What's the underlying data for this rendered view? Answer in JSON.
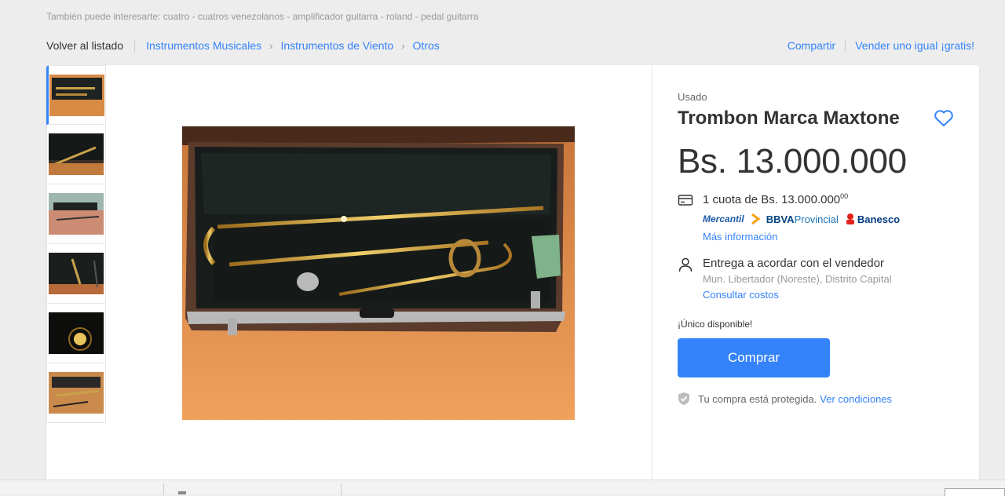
{
  "related": {
    "prefix": "También puede interesarte:",
    "items": [
      "cuatro",
      "cuatros venezolanos",
      "amplificador guitarra",
      "roland",
      "pedal guitarra"
    ],
    "sep": " - "
  },
  "breadcrumb": {
    "back_label": "Volver al listado",
    "items": [
      "Instrumentos Musicales",
      "Instrumentos de Viento",
      "Otros"
    ],
    "chevron": "›"
  },
  "actions": {
    "share_label": "Compartir",
    "sell_label": "Vender uno igual ¡gratis!"
  },
  "gallery": {
    "thumb_count": 6,
    "active_index": 0
  },
  "product": {
    "condition": "Usado",
    "title": "Trombon Marca Maxtone",
    "price": "Bs. 13.000.000",
    "installments_text": "1 cuota de Bs. 13.000.000",
    "installments_cents": "00",
    "banks": {
      "mercantil": "Mercantil",
      "bbva_bold": "BBVA",
      "bbva_rest": "Provincial",
      "banesco": "Banesco"
    },
    "more_info_label": "Más información",
    "delivery_title": "Entrega a acordar con el vendedor",
    "location": "Mun. Libertador (Noreste), Distrito Capital",
    "costs_label": "Consultar costos",
    "stock_text": "¡Único disponible!",
    "buy_label": "Comprar",
    "protection_text": "Tu compra está protegida.",
    "protection_link": "Ver condiciones"
  },
  "colors": {
    "accent": "#3483fa",
    "background": "#ededed",
    "text": "#333333"
  }
}
